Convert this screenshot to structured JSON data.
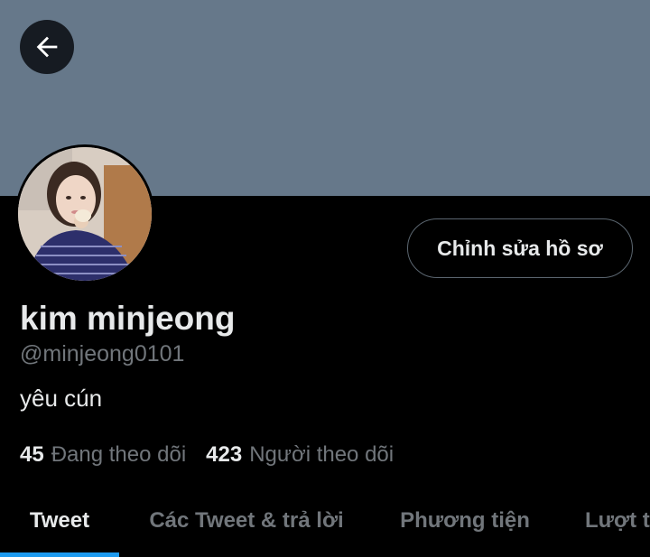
{
  "header": {
    "back_icon": "arrow-left-icon",
    "banner_color": "#66788a"
  },
  "profile": {
    "avatar_description": "profile photo",
    "edit_button_label": "Chỉnh sửa hồ sơ",
    "name": "kim minjeong",
    "handle": "@minjeong0101",
    "bio": "yêu cún"
  },
  "stats": {
    "following_count": "45",
    "following_label": "Đang theo dõi",
    "followers_count": "423",
    "followers_label": "Người theo dõi"
  },
  "tabs": [
    {
      "label": "Tweet",
      "active": true
    },
    {
      "label": "Các Tweet & trả lời",
      "active": false
    },
    {
      "label": "Phương tiện",
      "active": false
    },
    {
      "label": "Lượt thích",
      "active": false
    }
  ],
  "colors": {
    "accent": "#1d9bf0",
    "background": "#000000",
    "secondary_text": "#71767b"
  }
}
